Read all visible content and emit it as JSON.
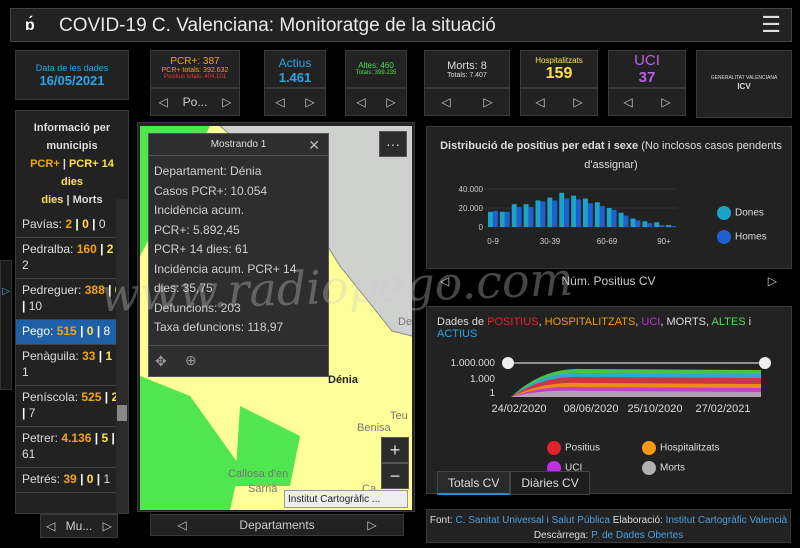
{
  "header": {
    "title": "COVID-19 C. Valenciana: Monitoratge de la situació",
    "logo": "ɒ́",
    "menu": "☰"
  },
  "kpis": {
    "date": {
      "label": "Data de les dades",
      "value": "16/05/2021",
      "color": "#2aa6e8"
    },
    "pcr": {
      "label": "PCR+: 387",
      "line2": "PCR+ totals: 392.632",
      "line3": "Positius totals: 404.101",
      "nav": "Po..."
    },
    "actius": {
      "label": "Actius",
      "value": "1.461"
    },
    "altes": {
      "label": "Altes: 460",
      "line2": "Totals: 399.235"
    },
    "morts": {
      "label": "Morts: 8",
      "line2": "Totals: 7.407"
    },
    "hosp": {
      "label": "Hospitalitzats",
      "value": "159"
    },
    "uci": {
      "label": "UCI",
      "value": "37"
    },
    "logo1": "GENERALITAT VALENCIANA",
    "logo2": "ICV"
  },
  "muni": {
    "head1": "Informació per municipis",
    "head2a": "PCR+",
    "head2b": "PCR+ 14 dies",
    "head2c": "Morts",
    "sep": "|",
    "rows": [
      {
        "name": "Pavías:",
        "a": "2",
        "b": "0",
        "c": "0"
      },
      {
        "name": "Pedralba:",
        "a": "160",
        "b": "2",
        "c": "2"
      },
      {
        "name": "Pedreguer:",
        "a": "388",
        "b": "0",
        "c": "10"
      },
      {
        "name": "Pego:",
        "a": "515",
        "b": "0",
        "c": "8"
      },
      {
        "name": "Penàguila:",
        "a": "33",
        "b": "1",
        "c": "1"
      },
      {
        "name": "Peníscola:",
        "a": "525",
        "b": "2",
        "c": "7"
      },
      {
        "name": "Petrer:",
        "a": "4.136",
        "b": "5",
        "c": "61"
      },
      {
        "name": "Petrés:",
        "a": "39",
        "b": "0",
        "c": "1"
      }
    ],
    "nav": "Mu..."
  },
  "popup": {
    "title": "Mostrando 1",
    "lines": [
      "Departament: Dénia",
      "Casos PCR+: 10.054",
      "Incidència acum.",
      "PCR+: 5.892,45",
      "PCR+ 14 dies: 61",
      "Incidència acum. PCR+ 14",
      "dies: 35,75",
      "Defuncions: 203",
      "Taxa defuncions: 118,97"
    ]
  },
  "map": {
    "labels": {
      "denia": "Dénia",
      "benissa": "Benisa",
      "callosa": "Callosa d'en",
      "sarria": "Sarrià",
      "teu": "Teu",
      "de": "De",
      "ca": "Ca"
    },
    "attribution": "Institut Cartogràfic ...",
    "nav": "Departaments",
    "more": "···",
    "zoom_in": "+",
    "zoom_out": "−"
  },
  "agechart": {
    "title_a": "Distribució de positius per edat i sexe",
    "title_b": "(No inclosos casos pendents d'assignar)",
    "yticks": [
      "40.000",
      "20.000",
      "0"
    ],
    "xticks": [
      "0-9",
      "30-39",
      "60-69",
      "90+"
    ],
    "legend": [
      "Dones",
      "Homes"
    ],
    "nav": "Núm. Positius CV",
    "colors": {
      "dones": "#1aa5c8",
      "homes": "#1f5fd0"
    },
    "dones": [
      16,
      16,
      24,
      24,
      28,
      31,
      36,
      33,
      30,
      26,
      20,
      15,
      9,
      6,
      5,
      2
    ],
    "homes": [
      17,
      16,
      21,
      21,
      27,
      28,
      30,
      29,
      25,
      22,
      18,
      12,
      7,
      4,
      2,
      1
    ]
  },
  "timechart": {
    "title_prefix": "Dades de",
    "t_pos": "POSITIUS",
    "t_hosp": "HOSPITALITZATS",
    "t_uci": "UCI",
    "t_morts": "MORTS",
    "t_altes": "ALTES",
    "t_i": "i",
    "t_actius": "ACTIUS",
    "yticks": [
      "1.000.000",
      "1.000",
      "1"
    ],
    "xticks": [
      "24/02/2020",
      "08/06/2020",
      "25/10/2020",
      "27/02/2021"
    ],
    "legend": [
      {
        "name": "Positius",
        "color": "#e3232a"
      },
      {
        "name": "Hospitalitzats",
        "color": "#f39a12"
      },
      {
        "name": "UCI",
        "color": "#c030e0"
      },
      {
        "name": "Morts",
        "color": "#b0b0b0"
      }
    ],
    "tabs": [
      "Totals CV",
      "Diàries CV"
    ]
  },
  "footer": {
    "font_label": "Font:",
    "font_val": "C. Sanitat Universal i Salut Pública",
    "elab_label": "Elaboració:",
    "elab_val": "Institut Cartogràfic Valencià",
    "desc_label": "Descàrrega:",
    "desc_val": "P. de Dades Obertes"
  },
  "watermark": "www.radiopego.com"
}
